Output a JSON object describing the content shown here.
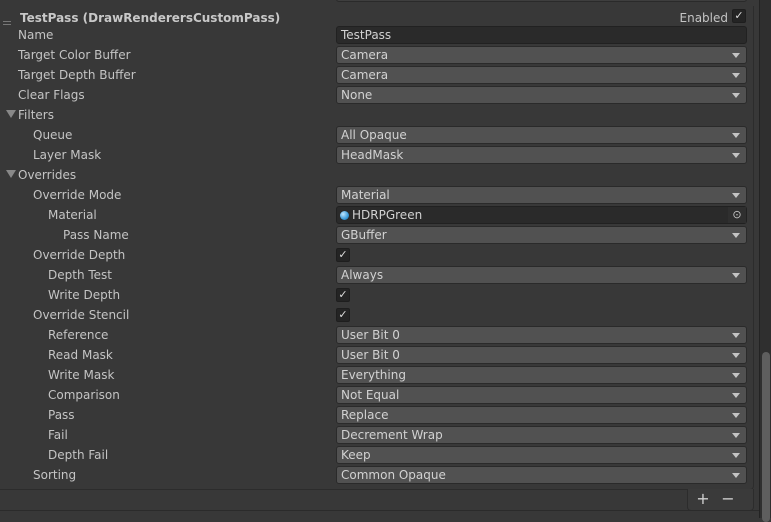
{
  "header": {
    "title": "TestPass (DrawRenderersCustomPass)",
    "enabled_label": "Enabled",
    "enabled": true
  },
  "rows": [
    {
      "label": "Name",
      "indent": 0,
      "type": "text",
      "value": "TestPass"
    },
    {
      "label": "Target Color Buffer",
      "indent": 0,
      "type": "dropdown",
      "value": "Camera"
    },
    {
      "label": "Target Depth Buffer",
      "indent": 0,
      "type": "dropdown",
      "value": "Camera"
    },
    {
      "label": "Clear Flags",
      "indent": 0,
      "type": "dropdown",
      "value": "None"
    },
    {
      "label": "Filters",
      "indent": 0,
      "type": "foldout"
    },
    {
      "label": "Queue",
      "indent": 1,
      "type": "dropdown",
      "value": "All Opaque"
    },
    {
      "label": "Layer Mask",
      "indent": 1,
      "type": "dropdown",
      "value": "HeadMask"
    },
    {
      "label": "Overrides",
      "indent": 0,
      "type": "foldout"
    },
    {
      "label": "Override Mode",
      "indent": 1,
      "type": "dropdown",
      "value": "Material"
    },
    {
      "label": "Material",
      "indent": 2,
      "type": "object",
      "value": "HDRPGreen"
    },
    {
      "label": "Pass Name",
      "indent": 3,
      "type": "dropdown",
      "value": "GBuffer"
    },
    {
      "label": "Override Depth",
      "indent": 1,
      "type": "checkbox",
      "value": true
    },
    {
      "label": "Depth Test",
      "indent": 2,
      "type": "dropdown",
      "value": "Always"
    },
    {
      "label": "Write Depth",
      "indent": 2,
      "type": "checkbox",
      "value": true
    },
    {
      "label": "Override Stencil",
      "indent": 1,
      "type": "checkbox",
      "value": true
    },
    {
      "label": "Reference",
      "indent": 2,
      "type": "dropdown",
      "value": "User Bit 0"
    },
    {
      "label": "Read Mask",
      "indent": 2,
      "type": "dropdown",
      "value": "User Bit 0"
    },
    {
      "label": "Write Mask",
      "indent": 2,
      "type": "dropdown",
      "value": "Everything"
    },
    {
      "label": "Comparison",
      "indent": 2,
      "type": "dropdown",
      "value": "Not Equal"
    },
    {
      "label": "Pass",
      "indent": 2,
      "type": "dropdown",
      "value": "Replace"
    },
    {
      "label": "Fail",
      "indent": 2,
      "type": "dropdown",
      "value": "Decrement Wrap"
    },
    {
      "label": "Depth Fail",
      "indent": 2,
      "type": "dropdown",
      "value": "Keep"
    },
    {
      "label": "Sorting",
      "indent": 1,
      "type": "dropdown",
      "value": "Common Opaque"
    }
  ],
  "footer": {
    "add_label": "+",
    "remove_label": "−"
  }
}
